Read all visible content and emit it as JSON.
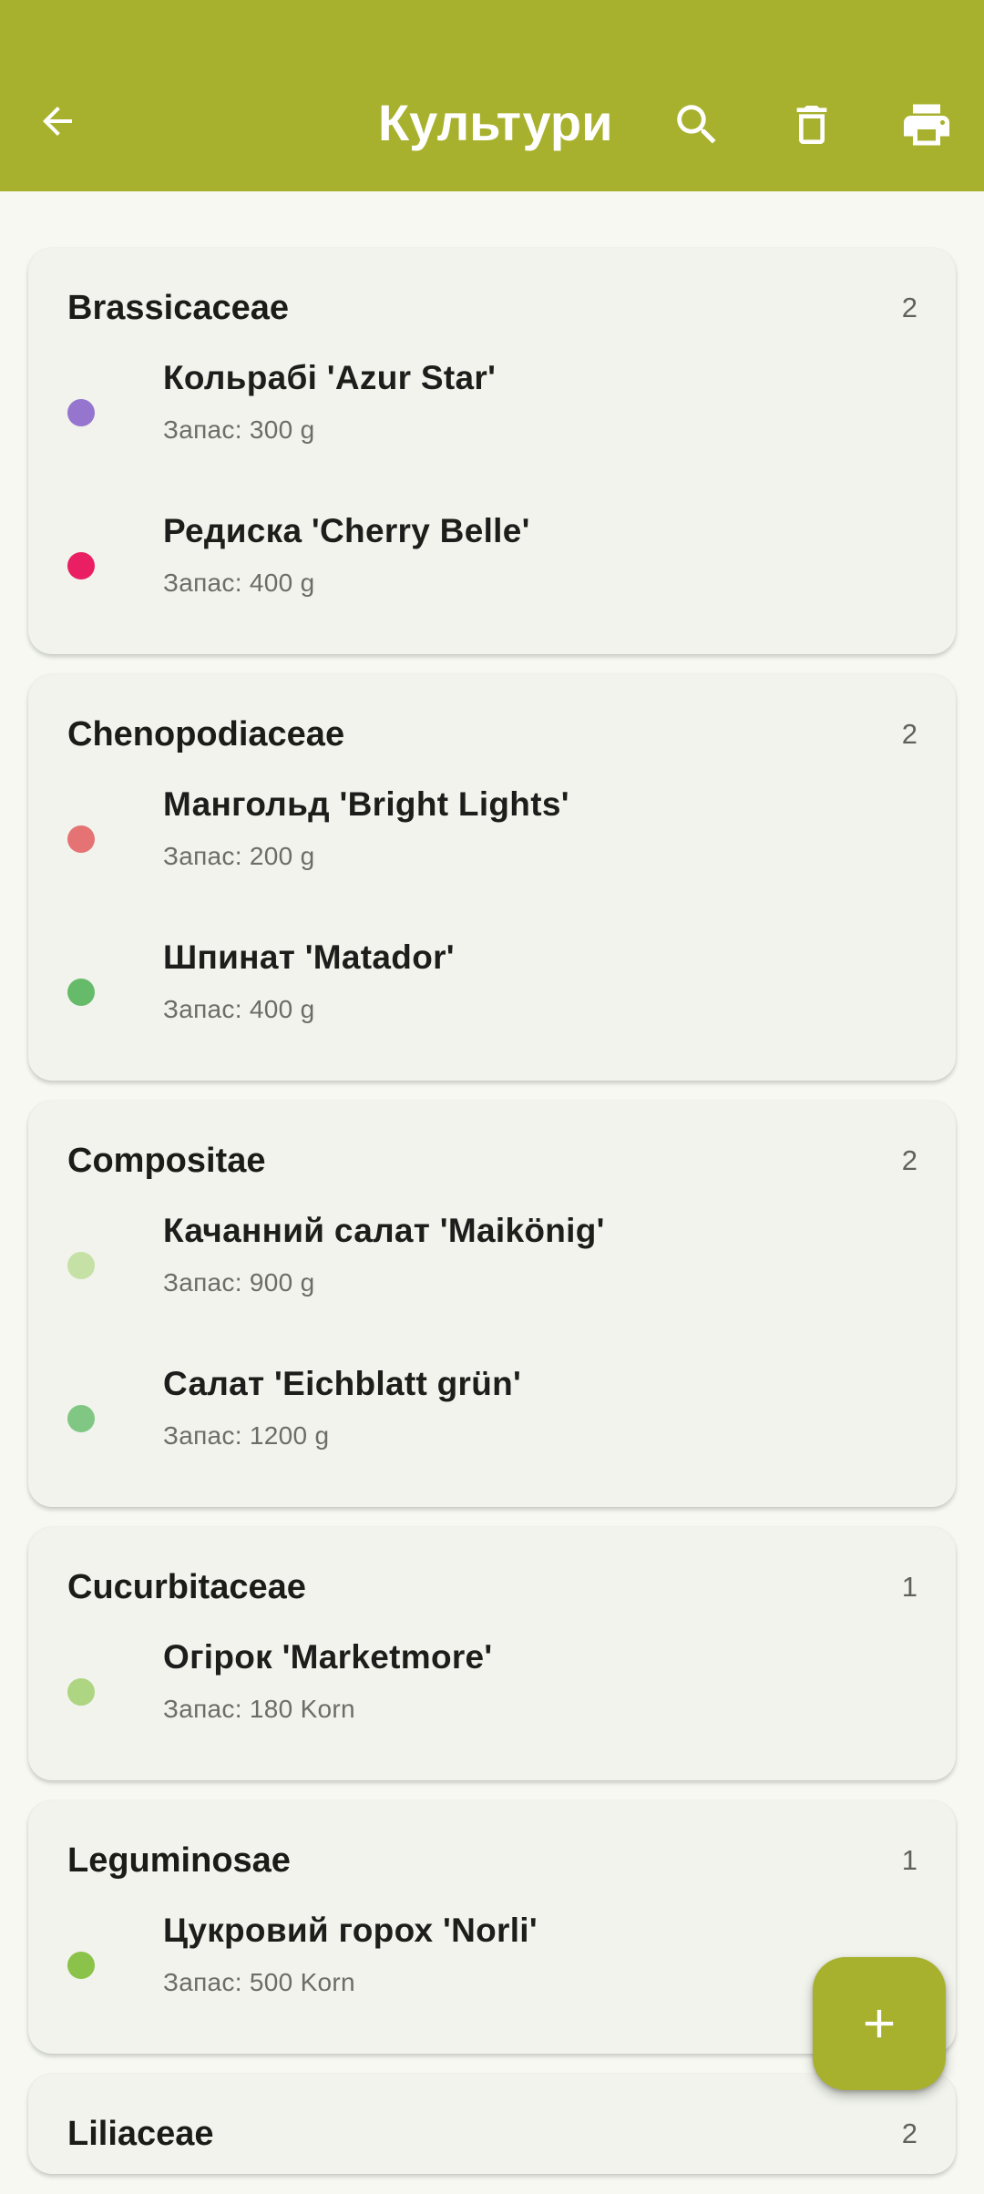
{
  "header": {
    "title": "Культури",
    "icons": [
      "arrow-back-icon",
      "search-icon",
      "delete-icon",
      "print-icon"
    ]
  },
  "colors": {
    "primary": "#a8b12d",
    "background": "#f6f8f1",
    "card": "#f1f3ec"
  },
  "groups": [
    {
      "family": "Brassicaceae",
      "count": "2",
      "items": [
        {
          "name": "Кольрабі 'Azur Star'",
          "stock": "Запас: 300 g",
          "color": "#9575cd"
        },
        {
          "name": "Редиска 'Cherry Belle'",
          "stock": "Запас: 400 g",
          "color": "#e91e63"
        }
      ]
    },
    {
      "family": "Chenopodiaceae",
      "count": "2",
      "items": [
        {
          "name": "Мангольд 'Bright Lights'",
          "stock": "Запас: 200 g",
          "color": "#e57373"
        },
        {
          "name": "Шпинат 'Matador'",
          "stock": "Запас: 400 g",
          "color": "#66bb6a"
        }
      ]
    },
    {
      "family": "Compositae",
      "count": "2",
      "items": [
        {
          "name": "Качанний салат 'Maikönig'",
          "stock": "Запас: 900 g",
          "color": "#c5e1a5"
        },
        {
          "name": "Салат 'Eichblatt grün'",
          "stock": "Запас: 1200 g",
          "color": "#81c784"
        }
      ]
    },
    {
      "family": "Cucurbitaceae",
      "count": "1",
      "items": [
        {
          "name": "Огірок 'Marketmore'",
          "stock": "Запас: 180 Korn",
          "color": "#aed581"
        }
      ]
    },
    {
      "family": "Leguminosae",
      "count": "1",
      "items": [
        {
          "name": "Цукровий горох 'Norli'",
          "stock": "Запас: 500 Korn",
          "color": "#8bc34a"
        }
      ]
    },
    {
      "family": "Liliaceae",
      "count": "2",
      "items": []
    }
  ],
  "fab": {
    "icon": "plus-icon"
  }
}
